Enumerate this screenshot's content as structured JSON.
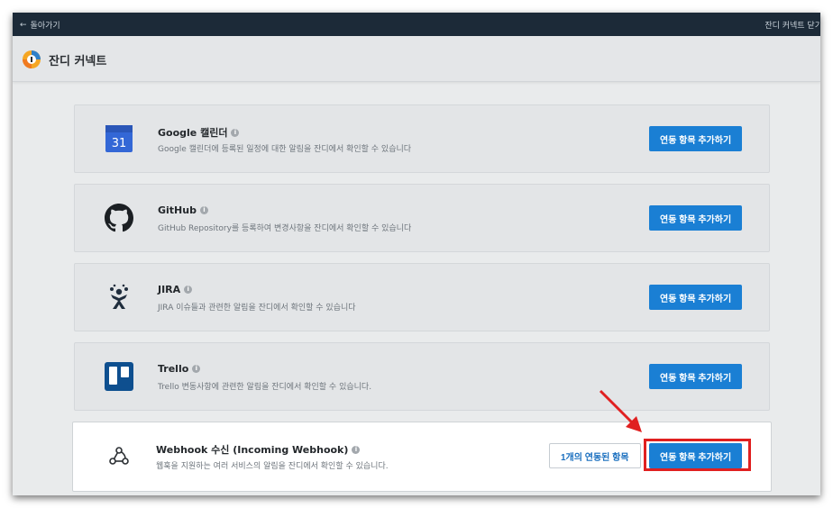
{
  "topbar": {
    "back_label": "돌아가기",
    "close_label": "잔디 커넥트 닫기"
  },
  "header": {
    "title": "잔디 커넥트"
  },
  "integrations": [
    {
      "name": "Google 캘린더",
      "desc": "Google 캘린더에 등록된 일정에 대한 알림을 잔디에서 확인할 수 있습니다",
      "button": "연동 항목 추가하기",
      "icon": "google-calendar-icon",
      "icon_text": "31"
    },
    {
      "name": "GitHub",
      "desc": "GitHub Repository를 등록하여 변경사항을 잔디에서 확인할 수 있습니다",
      "button": "연동 항목 추가하기",
      "icon": "github-icon"
    },
    {
      "name": "JIRA",
      "desc": "JIRA 이슈들과 관련한 알림을 잔디에서 확인할 수 있습니다",
      "button": "연동 항목 추가하기",
      "icon": "jira-icon"
    },
    {
      "name": "Trello",
      "desc": "Trello 변동사항에 관련한 알림을 잔디에서 확인할 수 있습니다.",
      "button": "연동 항목 추가하기",
      "icon": "trello-icon"
    },
    {
      "name": "Webhook 수신 (Incoming Webhook)",
      "desc": "웹훅을 지원하는 여러 서비스의 알림을 잔디에서 확인할 수 있습니다.",
      "button": "연동 항목 추가하기",
      "linked_label": "1개의 연동된 항목",
      "icon": "webhook-icon"
    }
  ],
  "colors": {
    "topbar": "#1c2a38",
    "accent": "#1a7fd4",
    "annotation": "#e02020"
  }
}
